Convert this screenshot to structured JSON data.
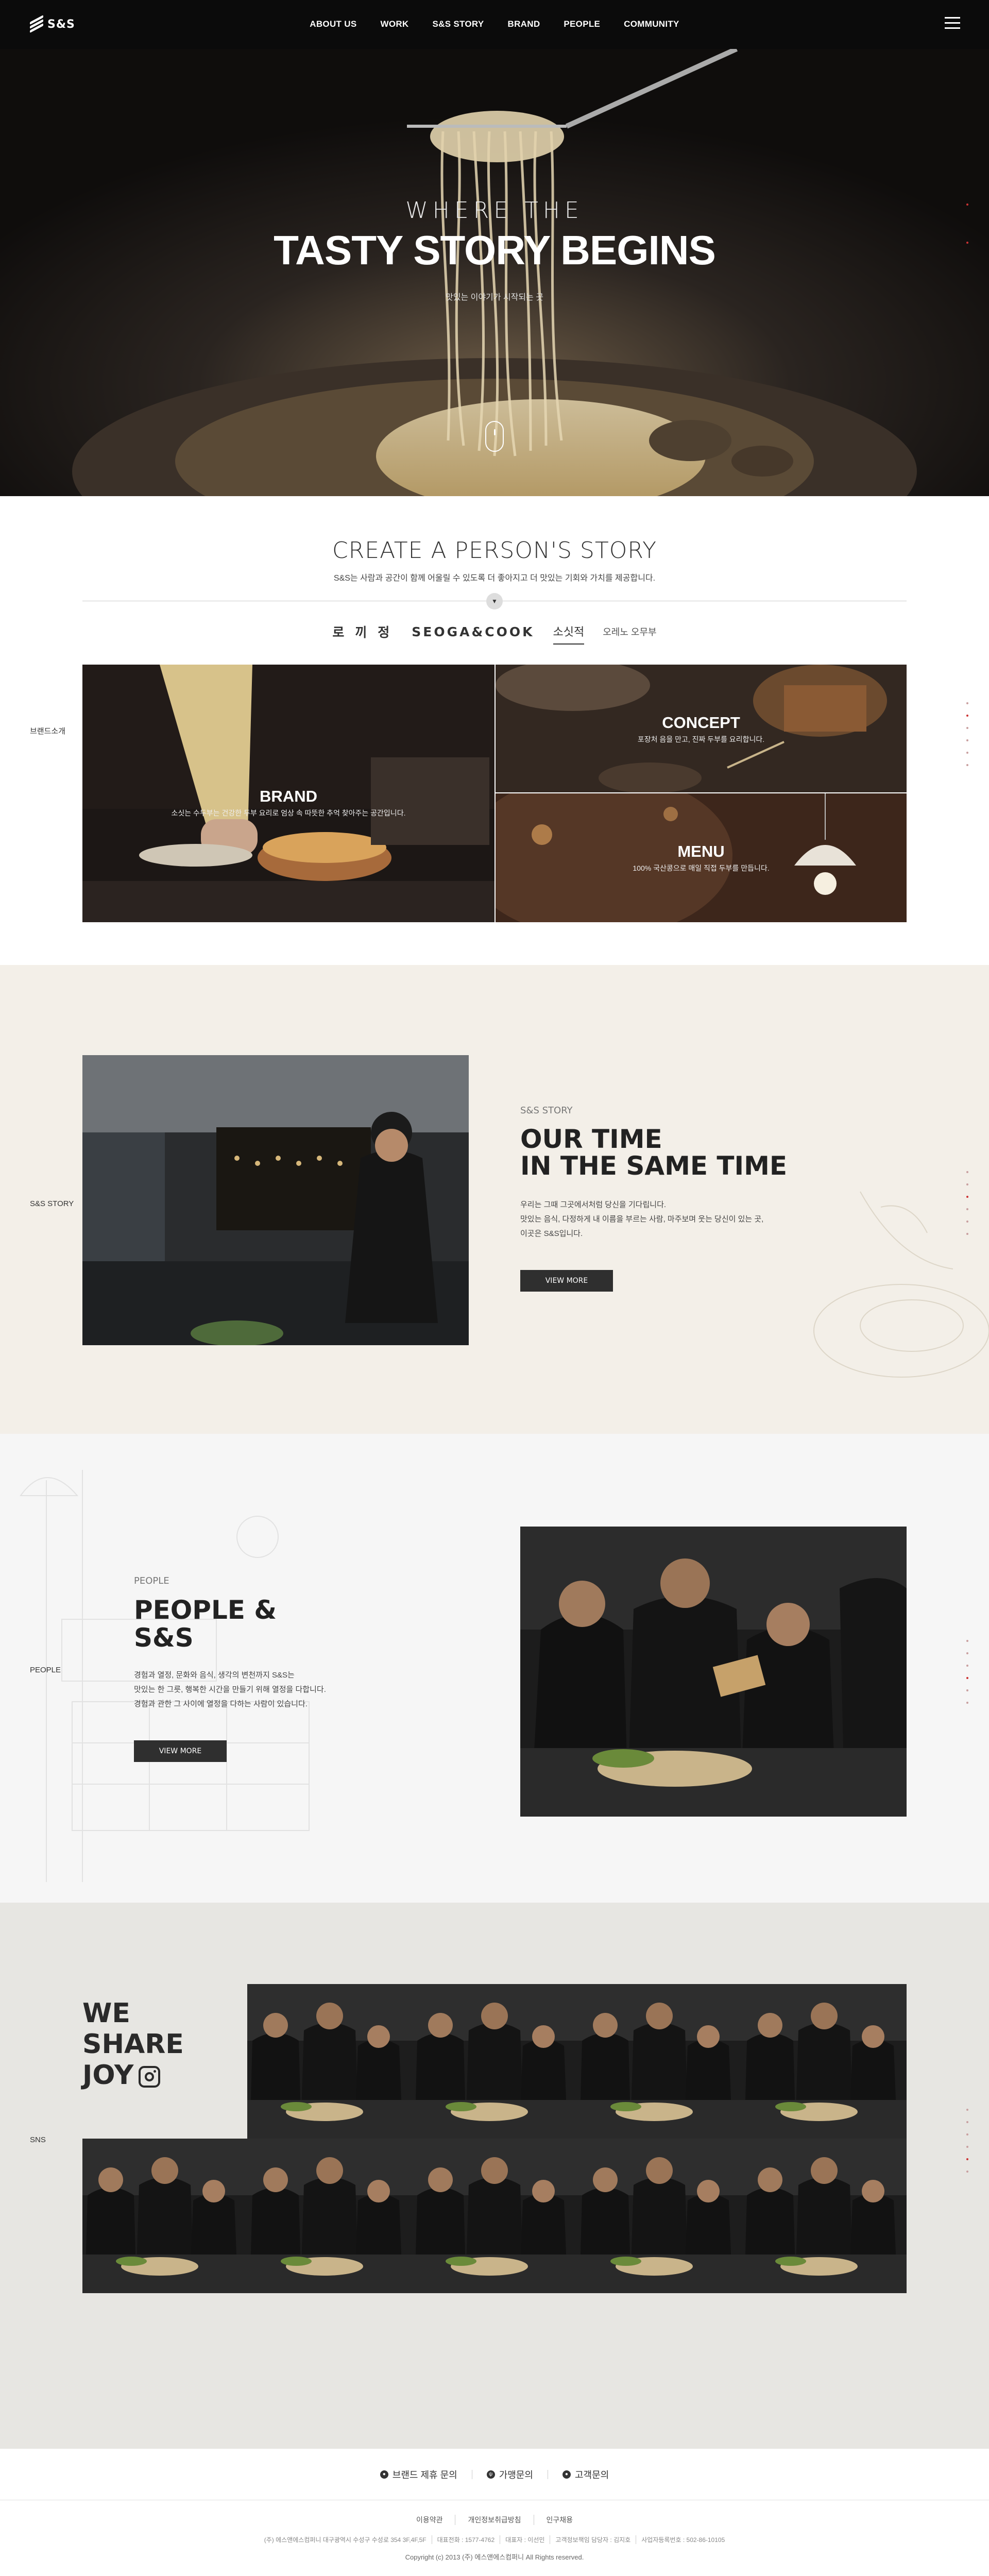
{
  "header": {
    "logo": "S&S",
    "nav": [
      "ABOUT US",
      "WORK",
      "S&S STORY",
      "BRAND",
      "PEOPLE",
      "COMMUNITY"
    ]
  },
  "hero": {
    "subtitle": "WHERE THE",
    "title": "TASTY STORY BEGINS",
    "desc": "맛있는 이야기가 시작되는 곳"
  },
  "intro": {
    "title": "CREATE A PERSON'S STORY",
    "desc": "S&S는 사람과 공간이 함께 어울릴 수 있도록 더 좋아지고 더 맛있는 기회와 가치를 제공합니다.",
    "side_label": "브랜드소개",
    "tabs": [
      "로 끼 정",
      "SEOGA&COOK",
      "소싯적",
      "오레노 오무부"
    ],
    "tiles": {
      "brand": {
        "title": "BRAND",
        "desc": "소싯는 수두부는 건강한 두부 요리로 엄상 속 따뜻한 추억 찾아주는 공간입니다."
      },
      "concept": {
        "title": "CONCEPT",
        "desc": "포장처 음을 만고, 진짜 두부를 요리합니다."
      },
      "menu": {
        "title": "MENU",
        "desc": "100% 국산콩으로 매일 직접 두부를 만듭니다."
      }
    }
  },
  "story": {
    "side_label": "S&S STORY",
    "sub": "S&S STORY",
    "title_line1": "OUR TIME",
    "title_line2": "IN THE SAME TIME",
    "text_line1": "우리는 그때 그곳에서처럼 당신을 기다립니다.",
    "text_line2": "맛있는 음식, 다정하게 내 이름을 부르는 사람, 마주보며 웃는 당신이 있는 곳,",
    "text_line3": "이곳은 S&S입니다.",
    "button": "VIEW MORE"
  },
  "people": {
    "side_label": "PEOPLE",
    "sub": "PEOPLE",
    "title_line1": "PEOPLE &",
    "title_line2": "S&S",
    "text_line1": "경험과 열정, 문화와 음식, 생각의 변천까지 S&S는",
    "text_line2": "맛있는 한 그릇, 행복한 시간을 만들기 위해 열정을 다합니다.",
    "text_line3": "경험과 관한 그 사이에 열정을 다하는 사람이 있습니다.",
    "button": "VIEW MORE"
  },
  "sns": {
    "side_label": "SNS",
    "title_line1": "WE",
    "title_line2": "SHARE",
    "title_line3": "JOY"
  },
  "footer": {
    "contact": [
      "브랜드 제휴 문의",
      "가맹문의",
      "고객문의"
    ],
    "links": [
      "이용약관",
      "개인정보취급방침",
      "인구채용"
    ],
    "info": [
      "(주) 에스앤에스컴퍼니 대구광역시 수성구 수성로 354 3F,4F,5F",
      "대표전화 : 1577-4762",
      "대표자 : 이선민",
      "고객정보책임 담당자 : 김지호",
      "사업자등록번호 : 502-86-10105"
    ],
    "copyright": "Copyright (c) 2013 (주) 에스앤에스컴퍼니 All Rights reserved."
  }
}
